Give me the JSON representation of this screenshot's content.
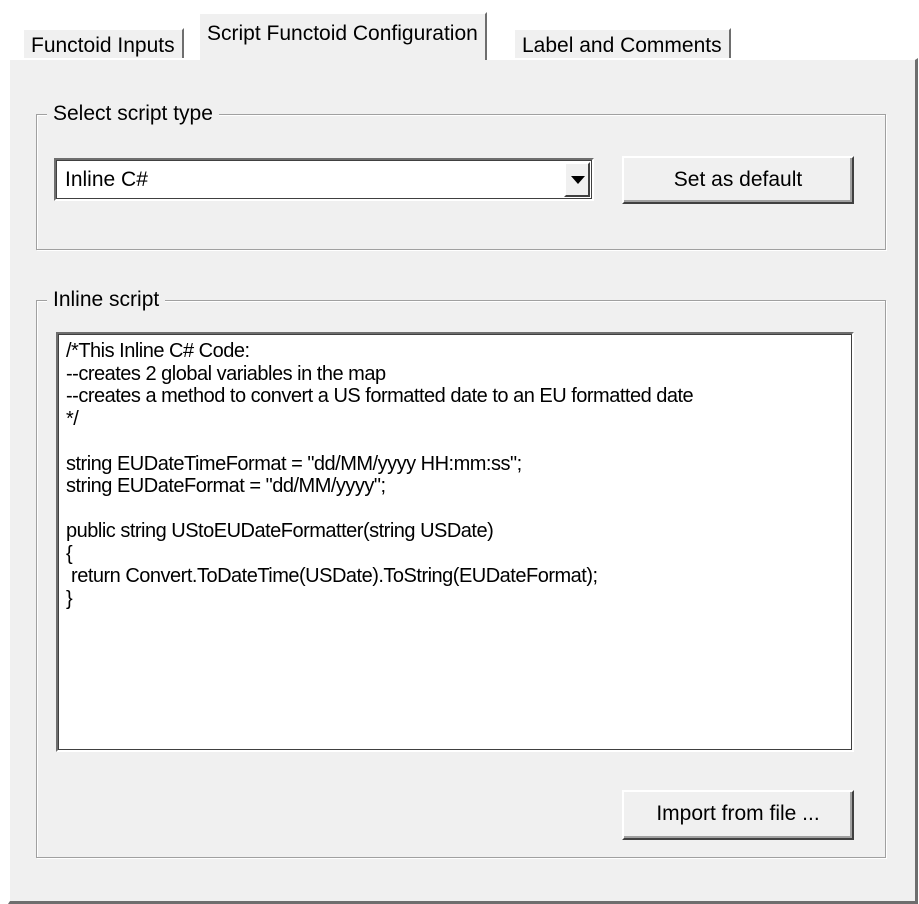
{
  "tabs": [
    {
      "label": "Functoid Inputs",
      "active": false
    },
    {
      "label": "Script Functoid Configuration",
      "active": true
    },
    {
      "label": "Label and Comments",
      "active": false
    }
  ],
  "script_type_group": {
    "legend": "Select script type",
    "selected_type": "Inline C#",
    "set_default_label": "Set as default"
  },
  "inline_script_group": {
    "legend": "Inline script",
    "code": "/*This Inline C# Code:\n--creates 2 global variables in the map\n--creates a method to convert a US formatted date to an EU formatted date\n*/\n\nstring EUDateTimeFormat = \"dd/MM/yyyy HH:mm:ss\";\nstring EUDateFormat = \"dd/MM/yyyy\";\n\npublic string UStoEUDateFormatter(string USDate)\n{\n return Convert.ToDateTime(USDate).ToString(EUDateFormat);\n}",
    "import_label": "Import from file ..."
  },
  "colors": {
    "face": "#f0f0f0",
    "highlight": "#ffffff",
    "shadow": "#6e6e6e",
    "dark_shadow": "#404040"
  }
}
